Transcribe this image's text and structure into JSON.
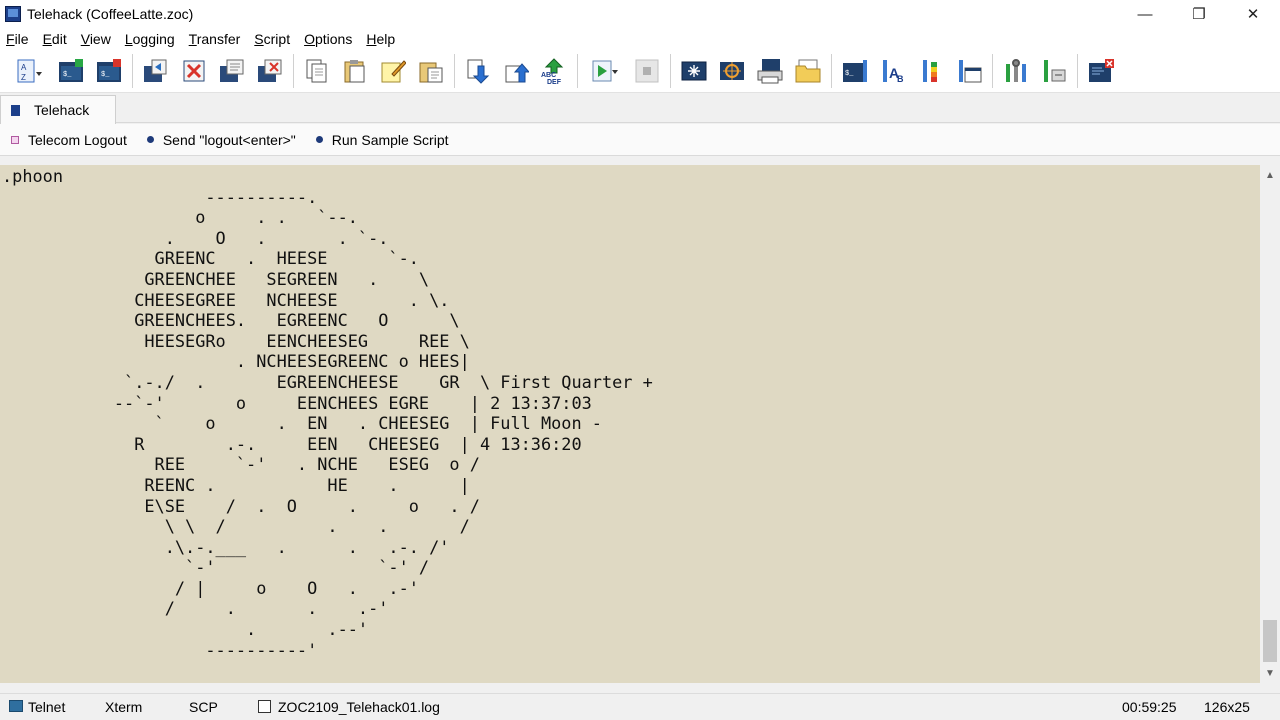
{
  "window": {
    "title": "Telehack (CoffeeLatte.zoc)",
    "minimize_glyph": "—",
    "restore_glyph": "❐",
    "close_glyph": "✕"
  },
  "menu": [
    {
      "label": "File"
    },
    {
      "label": "Edit"
    },
    {
      "label": "View"
    },
    {
      "label": "Logging"
    },
    {
      "label": "Transfer"
    },
    {
      "label": "Script"
    },
    {
      "label": "Options"
    },
    {
      "label": "Help"
    }
  ],
  "toolbar": {
    "icons": [
      "sort-az-icon",
      "new-session-icon",
      "quick-connect-icon",
      "connect-icon",
      "disconnect-icon",
      "session-copy-icon",
      "session-close-icon",
      "copy-icon",
      "paste-icon",
      "edit-note-icon",
      "paste-file-icon",
      "download-icon",
      "upload-icon",
      "abc-def-icon",
      "run-script-icon",
      "stop-icon",
      "terminal-emulation-icon",
      "target-icon",
      "printer-icon",
      "folder-icon",
      "session-profile-icon",
      "font-icon",
      "color-icon",
      "window-settings-icon",
      "tools-icon",
      "settings-icon",
      "exit-icon"
    ]
  },
  "tabs": [
    {
      "label": "Telehack",
      "active": true
    }
  ],
  "user_buttons": [
    {
      "label": "Telecom Logout"
    },
    {
      "label": "Send \"logout<enter>\""
    },
    {
      "label": "Run Sample Script"
    }
  ],
  "terminal": {
    "lines": [
      ".phoon",
      "                    ----------.",
      "                   o     . .   `--.",
      "                .    O   .       . `-.",
      "               GREENC   .  HEESE      `-.",
      "              GREENCHEE   SEGREEN   .    \\",
      "             CHEESEGREE   NCHEESE       . \\.",
      "             GREENCHEES.   EGREENC   O      \\",
      "              HEESEGRo    EENCHEESEG     REE \\",
      "                       . NCHEESEGREENC o HEES|",
      "            `.-./  .       EGREENCHEESE    GR  \\ First Quarter +",
      "           --`-'       o     EENCHEES EGRE    | 2 13:37:03",
      "               `    o      .  EN   . CHEESEG  | Full Moon -",
      "             R        .-.     EEN   CHEESEG  | 4 13:36:20",
      "               REE     `-'   . NCHE   ESEG  o /",
      "              REENC .           HE    .      |",
      "              E\\SE    /  .  O     .     o   . /",
      "                \\ \\  /          .    .       /",
      "                .\\.-.___   .      .   .-. /'",
      "                  `-'                `-' /",
      "                 / |     o    O   .   .-'",
      "                /     .       .    .-'",
      "                        .       .--'",
      "                    ----------'",
      "",
      "._"
    ]
  },
  "statusbar": {
    "protocol": "Telnet",
    "emulation": "Xterm",
    "transfer": "SCP",
    "logfile": "ZOC2109_Telehack01.log",
    "time": "00:59:25",
    "size": "126x25"
  },
  "scrollbar": {
    "up_glyph": "▲",
    "down_glyph": "▼"
  }
}
